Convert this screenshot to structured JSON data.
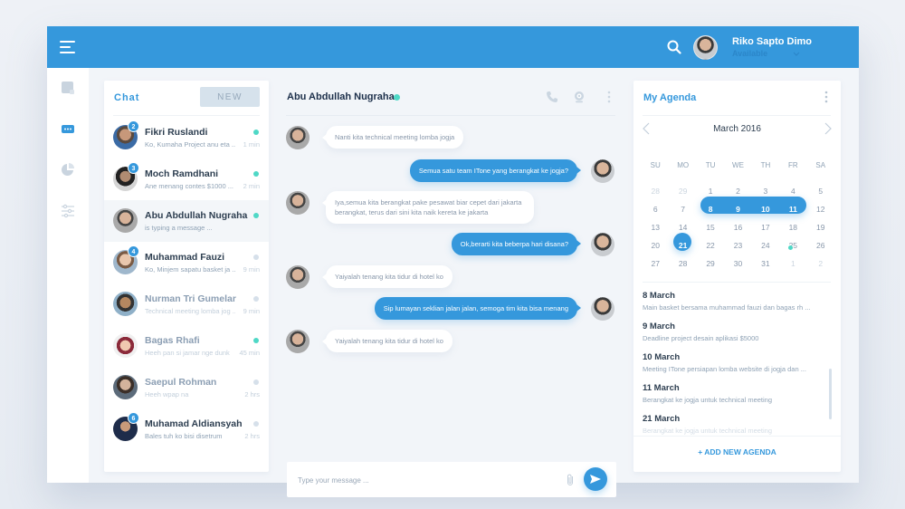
{
  "header": {
    "user_name": "Riko Sapto Dimo",
    "user_status": "Available",
    "icons": {
      "menu": "hamburger-icon",
      "search": "search-icon",
      "dropdown": "chevron-down-icon"
    }
  },
  "sidebar": {
    "items": [
      {
        "name": "notes",
        "icon": "note-icon",
        "active": false
      },
      {
        "name": "chat",
        "icon": "chat-bubble-icon",
        "active": true
      },
      {
        "name": "stats",
        "icon": "pie-chart-icon",
        "active": false
      },
      {
        "name": "settings",
        "icon": "sliders-icon",
        "active": false
      }
    ]
  },
  "chat_panel": {
    "title": "Chat",
    "new_label": "NEW",
    "contacts": [
      {
        "name": "Fikri Ruslandi",
        "message": "Ko, Kumaha Project anu eta ...",
        "time": "1 min",
        "badge": "2",
        "online": true,
        "dim": false
      },
      {
        "name": "Moch Ramdhani",
        "message": "Ane menang contes $1000 ...",
        "time": "2 min",
        "badge": "3",
        "online": true,
        "dim": false
      },
      {
        "name": "Abu Abdullah Nugraha",
        "message": "is typing a message ...",
        "time": "",
        "badge": "",
        "online": true,
        "dim": false,
        "active": true
      },
      {
        "name": "Muhammad Fauzi",
        "message": "Ko, Minjem sapatu basket ja ...",
        "time": "9 min",
        "badge": "4",
        "online": false,
        "dim": false
      },
      {
        "name": "Nurman Tri Gumelar",
        "message": "Technical meeting lomba jog ...",
        "time": "9 min",
        "badge": "",
        "online": false,
        "dim": true
      },
      {
        "name": "Bagas Rhafi",
        "message": "Heeh pan si jamar nge dunk",
        "time": "45 min",
        "badge": "",
        "online": true,
        "dim": true
      },
      {
        "name": "Saepul Rohman",
        "message": "Heeh wpap na",
        "time": "2 hrs",
        "badge": "",
        "online": false,
        "dim": true
      },
      {
        "name": "Muhamad Aldiansyah",
        "message": "Bales tuh ko bisi disetrum",
        "time": "2 hrs",
        "badge": "6",
        "online": false,
        "dim": false
      }
    ]
  },
  "conversation": {
    "title": "Abu Abdullah Nugraha",
    "online": true,
    "icons": {
      "call": "phone-icon",
      "video": "webcam-icon",
      "more": "kebab-menu-icon"
    },
    "messages": [
      {
        "dir": "in",
        "text": "Nanti  kita technical meeting lomba jogja"
      },
      {
        "dir": "out",
        "text": "Semua satu team ITone yang berangkat ke jogja?"
      },
      {
        "dir": "in",
        "text": "Iya,semua kita berangkat pake pesawat biar cepet dari  jakarta berangkat, terus dari sini kita naik kereta ke jakarta"
      },
      {
        "dir": "out",
        "text": "Ok,berarti kita beberpa hari disana?"
      },
      {
        "dir": "in",
        "text": "Yaiyalah tenang kita tidur di hotel ko"
      },
      {
        "dir": "out",
        "text": "Sip lumayan seklian jalan jalan, semoga tim kita bisa menang"
      },
      {
        "dir": "in",
        "text": "Yaiyalah tenang kita tidur di hotel ko"
      }
    ],
    "composer_placeholder": "Type your message ...",
    "composer_value": ""
  },
  "agenda": {
    "title": "My Agenda",
    "month_label": "March 2016",
    "weekdays": [
      "SU",
      "MO",
      "TU",
      "WE",
      "TH",
      "FR",
      "SA"
    ],
    "weeks": [
      [
        "28",
        "29",
        "1",
        "2",
        "3",
        "4",
        "5"
      ],
      [
        "6",
        "7",
        "8",
        "9",
        "10",
        "11",
        "12"
      ],
      [
        "13",
        "14",
        "15",
        "16",
        "17",
        "18",
        "19"
      ],
      [
        "20",
        "21",
        "22",
        "23",
        "24",
        "25",
        "26"
      ],
      [
        "27",
        "28",
        "29",
        "30",
        "31",
        "1",
        "2"
      ]
    ],
    "selected_range": [
      "8",
      "9",
      "10",
      "11"
    ],
    "today": "21",
    "event_marker_day": "25",
    "events": [
      {
        "date": "8 March",
        "desc": "Main basket bersama muhammad fauzi dan bagas rh ..."
      },
      {
        "date": "9 March",
        "desc": "Deadline project desain aplikasi $5000"
      },
      {
        "date": "10 March",
        "desc": "Meeting ITone persiapan lomba website di jogja dan ..."
      },
      {
        "date": "11 March",
        "desc": "Berangkat ke jogja untuk technical meeting"
      },
      {
        "date": "21 March",
        "desc": "Berangkat ke jogja untuk technical meeting"
      }
    ],
    "add_label": "+ ADD NEW AGENDA"
  },
  "colors": {
    "accent": "#3598dc",
    "online": "#4fd8c6",
    "offline": "#d6e0ea",
    "text_dark": "#2d3e50"
  }
}
